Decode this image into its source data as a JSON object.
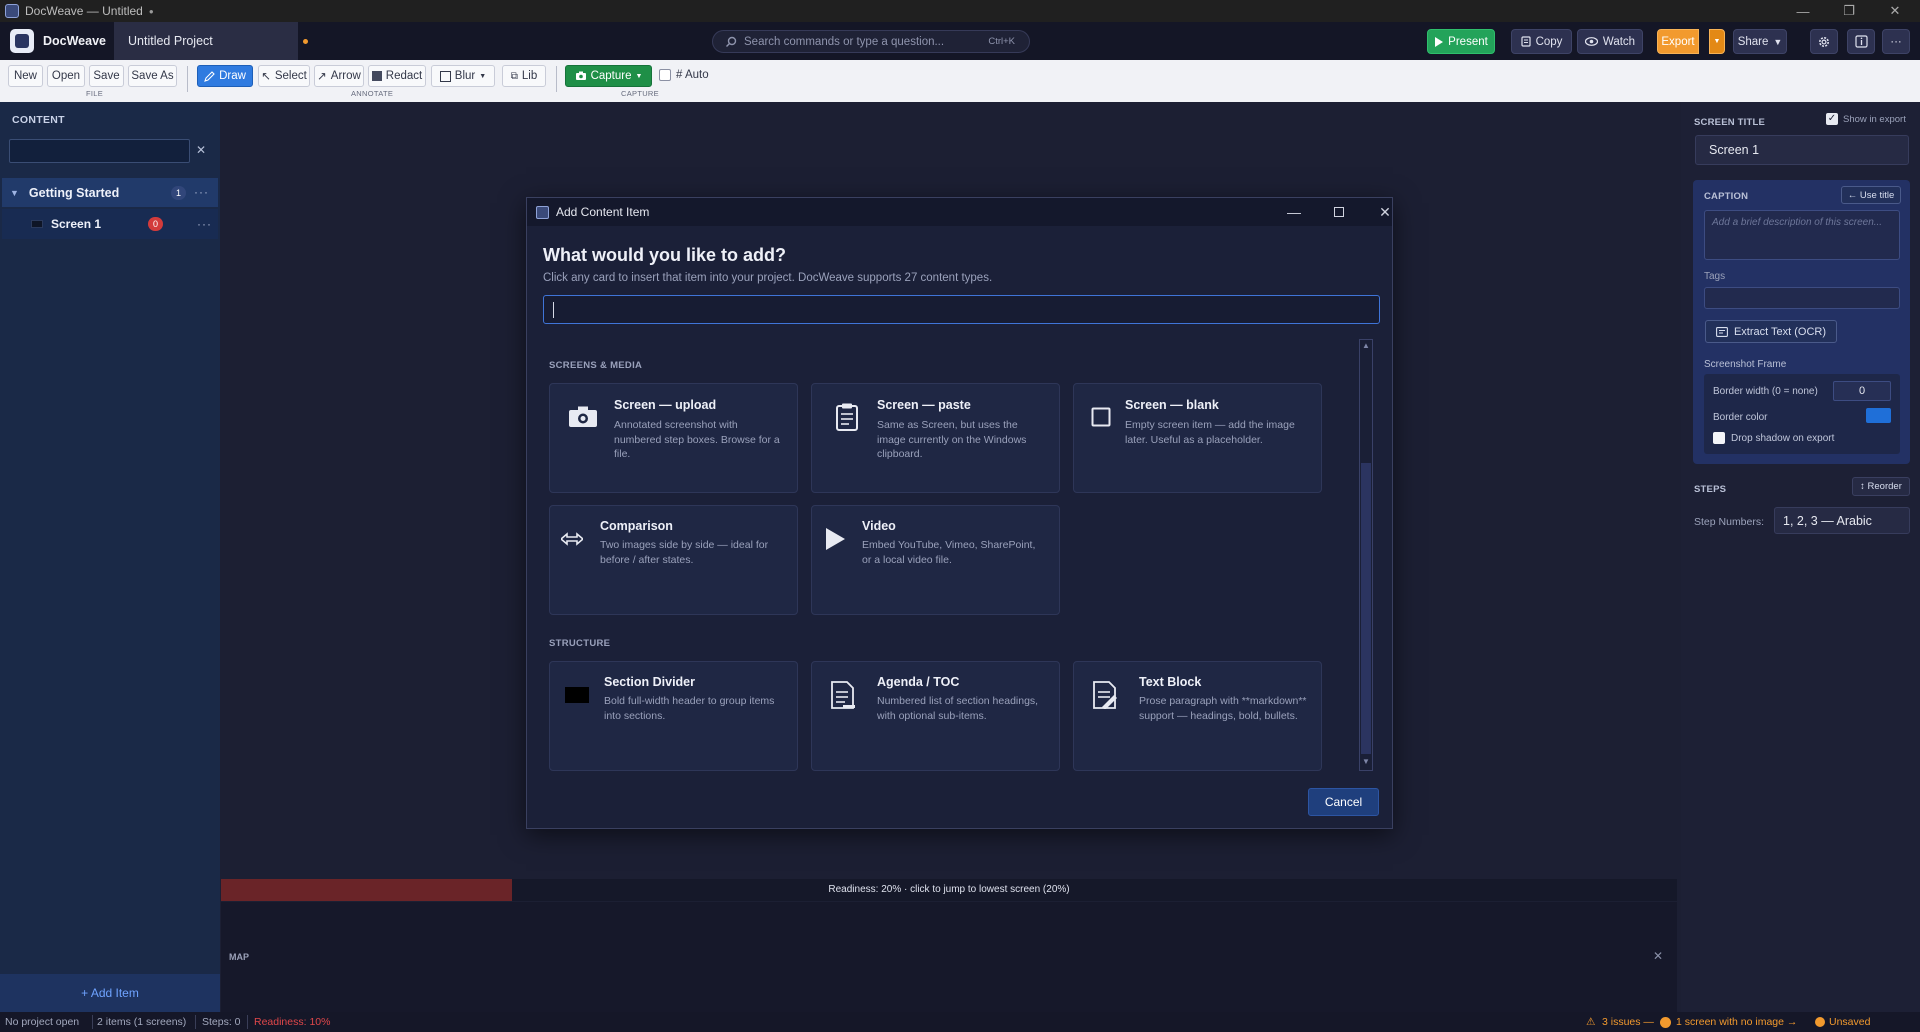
{
  "window": {
    "title": "DocWeave — Untitled",
    "dirty_marker": "●",
    "controls": [
      "—",
      "❐",
      "✕"
    ]
  },
  "header": {
    "app_name": "DocWeave",
    "project_tab": "Untitled Project",
    "search_placeholder": "Search commands or type a question...",
    "search_shortcut": "Ctrl+K",
    "buttons": {
      "present": "Present",
      "copy": "Copy",
      "watch": "Watch",
      "export": "Export",
      "share": "Share"
    },
    "more": "···"
  },
  "toolbar": {
    "file": {
      "new": "New",
      "open": "Open",
      "save": "Save",
      "save_as": "Save As",
      "group_label": "FILE"
    },
    "annotate": {
      "draw": "Draw",
      "select": "Select",
      "arrow": "Arrow",
      "redact": "Redact",
      "blur": "Blur",
      "lib": "Lib",
      "group_label": "ANNOTATE"
    },
    "capture": {
      "capture": "Capture",
      "auto": "# Auto",
      "group_label": "CAPTURE"
    }
  },
  "sidebar": {
    "heading": "CONTENT",
    "filter_clear": "✕",
    "group": {
      "name": "Getting Started",
      "count": "1",
      "more": "···"
    },
    "items": [
      {
        "name": "Screen 1",
        "badge": "0",
        "more": "···"
      }
    ],
    "add_item": "+ Add Item"
  },
  "canvas": {
    "readiness_text": "Readiness: 20%  ·  click to jump to lowest screen (20%)",
    "readiness_value": 0.2,
    "map_label": "MAP",
    "map_close": "✕"
  },
  "right_panel": {
    "screen_title_label": "SCREEN TITLE",
    "show_in_export": "Show in export",
    "screen_title_value": "Screen 1",
    "caption_label": "CAPTION",
    "use_title": "← Use title",
    "caption_placeholder": "Add a brief description of this screen...",
    "tags_label": "Tags",
    "ocr_button": "Extract Text (OCR)",
    "screenshot_frame_label": "Screenshot Frame",
    "border_width_label": "Border width (0 = none)",
    "border_width_value": "0",
    "border_color_label": "Border color",
    "border_color": "#1f6fd8",
    "drop_shadow_label": "Drop shadow on export",
    "steps_label": "STEPS",
    "reorder": "↕ Reorder",
    "step_numbers_label": "Step Numbers:",
    "step_numbers_value": "1, 2, 3  — Arabic"
  },
  "statusbar": {
    "project": "No project open",
    "items": "2 items  (1 screens)",
    "steps": "Steps: 0",
    "readiness": "Readiness: 10%",
    "issues": "3 issues —",
    "no_image": "1 screen with no image →",
    "unsaved": "Unsaved"
  },
  "dialog": {
    "title": "Add Content Item",
    "heading": "What would you like to add?",
    "subheading": "Click any card to insert that item into your project. DocWeave supports 27 content types.",
    "sections": [
      {
        "label": "SCREENS & MEDIA",
        "cards": [
          {
            "icon": "camera-icon",
            "title": "Screen — upload",
            "desc": "Annotated screenshot with numbered step boxes. Browse for a file."
          },
          {
            "icon": "clipboard-icon",
            "title": "Screen — paste",
            "desc": "Same as Screen, but uses the image currently on the Windows clipboard."
          },
          {
            "icon": "blank-square-icon",
            "title": "Screen — blank",
            "desc": "Empty screen item — add the image later. Useful as a placeholder."
          },
          {
            "icon": "compare-arrows-icon",
            "title": "Comparison",
            "desc": "Two images side by side — ideal for before / after states."
          },
          {
            "icon": "play-icon",
            "title": "Video",
            "desc": "Embed YouTube, Vimeo, SharePoint, or a local video file."
          }
        ]
      },
      {
        "label": "STRUCTURE",
        "cards": [
          {
            "icon": "divider-block-icon",
            "title": "Section Divider",
            "desc": "Bold full-width header to group items into sections."
          },
          {
            "icon": "list-doc-icon",
            "title": "Agenda / TOC",
            "desc": "Numbered list of section headings, with optional sub-items."
          },
          {
            "icon": "text-doc-icon",
            "title": "Text Block",
            "desc": "Prose paragraph with **markdown** support — headings, bold, bullets."
          }
        ]
      }
    ],
    "cancel": "Cancel"
  },
  "colors": {
    "accent_blue": "#2f7be0",
    "present_green": "#23a35a",
    "export_orange": "#f29a2e",
    "error_red": "#d33b3b"
  }
}
